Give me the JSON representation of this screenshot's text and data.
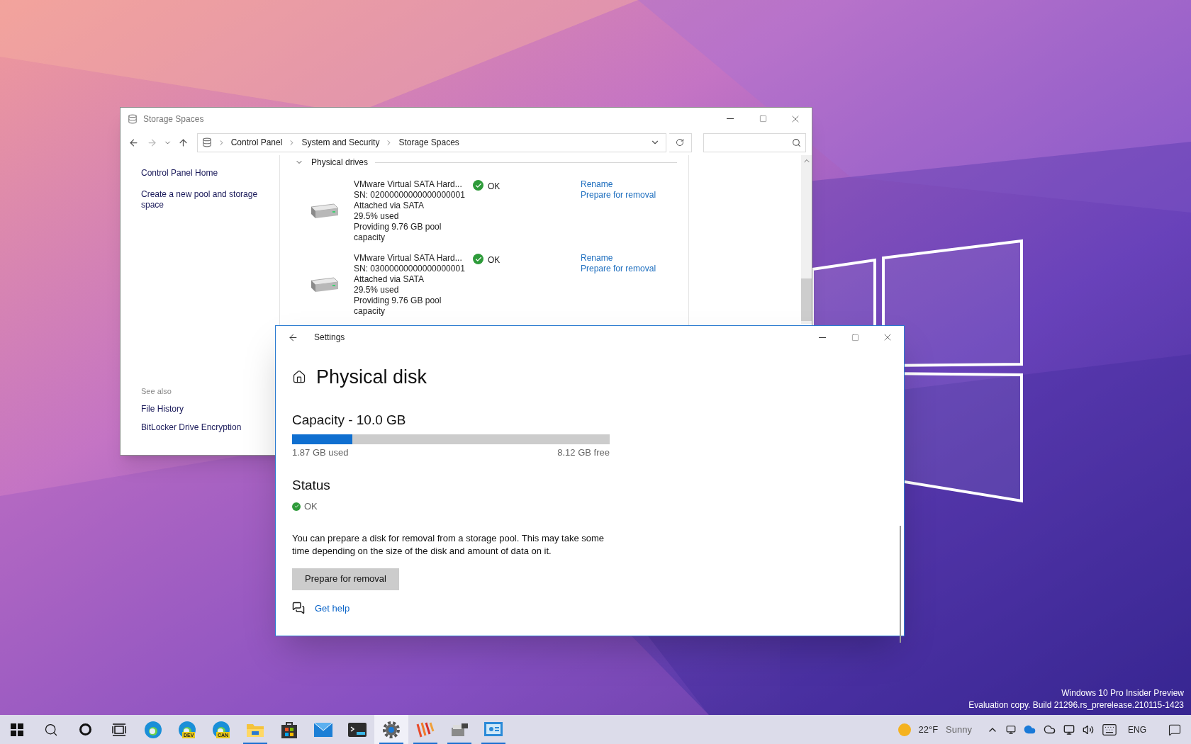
{
  "desktop": {
    "watermark": [
      "Windows 10 Pro Insider Preview",
      "Evaluation copy. Build 21296.rs_prerelease.210115-1423"
    ]
  },
  "control_panel": {
    "title": "Storage Spaces",
    "breadcrumb": [
      "Control Panel",
      "System and Security",
      "Storage Spaces"
    ],
    "sidebar": {
      "items": [
        "Control Panel Home",
        "Create a new pool and storage space"
      ],
      "see_also": {
        "heading": "See also",
        "items": [
          "File History",
          "BitLocker Drive Encryption"
        ]
      }
    },
    "section": {
      "title": "Physical drives",
      "expanded": true
    },
    "drives": [
      {
        "name": "VMware Virtual SATA Hard...",
        "details": [
          "SN: 02000000000000000001",
          "Attached via SATA",
          "29.5% used",
          "Providing 9.76 GB pool capacity"
        ],
        "status": "OK",
        "actions": [
          "Rename",
          "Prepare for removal"
        ]
      },
      {
        "name": "VMware Virtual SATA Hard...",
        "details": [
          "SN: 03000000000000000001",
          "Attached via SATA",
          "29.5% used",
          "Providing 9.76 GB pool capacity"
        ],
        "status": "OK",
        "actions": [
          "Rename",
          "Prepare for removal"
        ]
      }
    ]
  },
  "settings": {
    "title": "Settings",
    "heading": "Physical disk",
    "capacity": {
      "title": "Capacity - 10.0 GB",
      "level": 0.19,
      "used": "1.87 GB used",
      "free": "8.12 GB free"
    },
    "status": {
      "title": "Status",
      "value": "OK"
    },
    "description": "You can prepare a disk for removal from a storage pool. This may take some time depending on the size of the disk and amount of data on it.",
    "button": "Prepare for removal",
    "help_link": "Get help"
  },
  "taskbar": {
    "apps": [
      {
        "kind": "start",
        "running": false,
        "selected": false
      },
      {
        "kind": "search",
        "running": false,
        "selected": false
      },
      {
        "kind": "cortana",
        "running": false,
        "selected": false
      },
      {
        "kind": "taskview",
        "running": false,
        "selected": false
      },
      {
        "kind": "edge",
        "running": false,
        "selected": false
      },
      {
        "kind": "edge",
        "badge": "DEV",
        "running": false,
        "selected": false
      },
      {
        "kind": "edge",
        "badge": "CAN",
        "running": false,
        "selected": false
      },
      {
        "kind": "explorer",
        "running": true,
        "selected": false
      },
      {
        "kind": "store",
        "running": false,
        "selected": false
      },
      {
        "kind": "mail",
        "running": false,
        "selected": false
      },
      {
        "kind": "terminal",
        "running": false,
        "selected": false
      },
      {
        "kind": "settings",
        "running": true,
        "selected": true
      },
      {
        "kind": "stripes",
        "running": true,
        "selected": false
      },
      {
        "kind": "vm",
        "running": true,
        "selected": false
      },
      {
        "kind": "panel",
        "running": true,
        "selected": false
      }
    ],
    "weather": {
      "temperature": "22°F",
      "condition": "Sunny"
    },
    "language": "ENG"
  }
}
